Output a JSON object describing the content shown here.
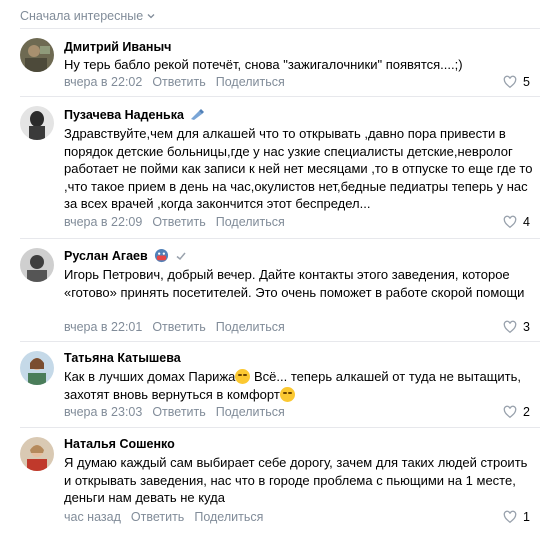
{
  "sort_label": "Сначала интересные",
  "actions": {
    "reply": "Ответить",
    "share": "Поделиться"
  },
  "comments": [
    {
      "author": "Дмитрий Иваныч",
      "text": "Ну терь бабло рекой потечёт, снова \"зажигалочники\" появятся....;)",
      "time": "вчера в 22:02",
      "likes": "5"
    },
    {
      "author": "Пузачева Наденька",
      "text": "Здравствуйте,чем для алкашей что то открывать ,давно пора привести в порядок детские больницы,где у нас узкие специалисты детские,невролог работает не пойми как записи к ней нет месяцами ,то в отпуске то еще где то ,что такое прием в день на час,окулистов нет,бедные педиатры теперь у нас за всех врачей ,когда закончится этот беспредел...",
      "time": "вчера в 22:09",
      "likes": "4"
    },
    {
      "author": "Руслан Агаев",
      "text": "Игорь Петрович, добрый вечер. Дайте контакты этого заведения, которое «готово» принять посетителей. Это очень поможет в работе скорой помощи",
      "time": "вчера в 22:01",
      "likes": "3"
    },
    {
      "author": "Татьяна Катышева",
      "text_a": "Как в лучших домах Парижа",
      "text_b": " Всё... теперь алкашей от туда не вытащить, захотят вновь вернуться в комфорт",
      "time": "вчера в 23:03",
      "likes": "2"
    },
    {
      "author": "Наталья Сошенко",
      "text": "Я думаю каждый сам выбирает себе дорогу, зачем для таких людей строить и открывать заведения, нас что в городе проблема с пьющими на 1 месте, деньги нам девать не куда",
      "time": "час назад",
      "likes": "1"
    }
  ],
  "colors": {
    "secondary_text": "#818c99",
    "divider": "#e7e8ec",
    "heart": "#99a2ad"
  }
}
